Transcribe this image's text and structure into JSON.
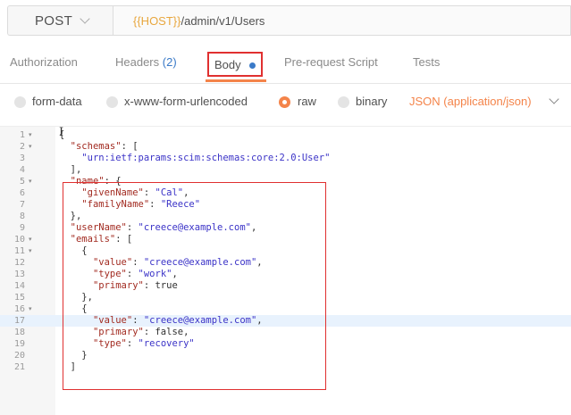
{
  "request": {
    "method": "POST",
    "url_variable": "{{HOST}}",
    "url_path": "/admin/v1/Users"
  },
  "tabs": {
    "authorization": "Authorization",
    "headers": "Headers",
    "headers_count": "(2)",
    "body": "Body",
    "pre_request": "Pre-request Script",
    "tests": "Tests"
  },
  "body_options": {
    "form_data": "form-data",
    "urlencoded": "x-www-form-urlencoded",
    "raw": "raw",
    "binary": "binary",
    "selected": "raw",
    "content_type": "JSON (application/json)"
  },
  "colors": {
    "accent": "#f4844a",
    "highlight_border": "#e03030",
    "link_blue": "#3a7ac8",
    "variable": "#e8a73f"
  },
  "editor": {
    "cursor_line": 17,
    "lines": [
      {
        "n": "1",
        "fold": true,
        "parts": [
          {
            "t": "p",
            "v": "{"
          }
        ]
      },
      {
        "n": "2",
        "fold": true,
        "parts": [
          {
            "t": "p",
            "v": "  "
          },
          {
            "t": "k",
            "v": "\"schemas\""
          },
          {
            "t": "p",
            "v": ": ["
          }
        ]
      },
      {
        "n": "3",
        "fold": false,
        "parts": [
          {
            "t": "p",
            "v": "    "
          },
          {
            "t": "s",
            "v": "\"urn:ietf:params:scim:schemas:core:2.0:User\""
          }
        ]
      },
      {
        "n": "4",
        "fold": false,
        "parts": [
          {
            "t": "p",
            "v": "  ],"
          }
        ]
      },
      {
        "n": "5",
        "fold": true,
        "parts": [
          {
            "t": "p",
            "v": "  "
          },
          {
            "t": "k",
            "v": "\"name\""
          },
          {
            "t": "p",
            "v": ": {"
          }
        ]
      },
      {
        "n": "6",
        "fold": false,
        "parts": [
          {
            "t": "p",
            "v": "    "
          },
          {
            "t": "k",
            "v": "\"givenName\""
          },
          {
            "t": "p",
            "v": ": "
          },
          {
            "t": "s",
            "v": "\"Cal\""
          },
          {
            "t": "p",
            "v": ","
          }
        ]
      },
      {
        "n": "7",
        "fold": false,
        "parts": [
          {
            "t": "p",
            "v": "    "
          },
          {
            "t": "k",
            "v": "\"familyName\""
          },
          {
            "t": "p",
            "v": ": "
          },
          {
            "t": "s",
            "v": "\"Reece\""
          }
        ]
      },
      {
        "n": "8",
        "fold": false,
        "parts": [
          {
            "t": "p",
            "v": "  },"
          }
        ]
      },
      {
        "n": "9",
        "fold": false,
        "parts": [
          {
            "t": "p",
            "v": "  "
          },
          {
            "t": "k",
            "v": "\"userName\""
          },
          {
            "t": "p",
            "v": ": "
          },
          {
            "t": "s",
            "v": "\"creece@example.com\""
          },
          {
            "t": "p",
            "v": ","
          }
        ]
      },
      {
        "n": "10",
        "fold": true,
        "parts": [
          {
            "t": "p",
            "v": "  "
          },
          {
            "t": "k",
            "v": "\"emails\""
          },
          {
            "t": "p",
            "v": ": ["
          }
        ]
      },
      {
        "n": "11",
        "fold": true,
        "parts": [
          {
            "t": "p",
            "v": "    {"
          }
        ]
      },
      {
        "n": "12",
        "fold": false,
        "parts": [
          {
            "t": "p",
            "v": "      "
          },
          {
            "t": "k",
            "v": "\"value\""
          },
          {
            "t": "p",
            "v": ": "
          },
          {
            "t": "s",
            "v": "\"creece@example.com\""
          },
          {
            "t": "p",
            "v": ","
          }
        ]
      },
      {
        "n": "13",
        "fold": false,
        "parts": [
          {
            "t": "p",
            "v": "      "
          },
          {
            "t": "k",
            "v": "\"type\""
          },
          {
            "t": "p",
            "v": ": "
          },
          {
            "t": "s",
            "v": "\"work\""
          },
          {
            "t": "p",
            "v": ","
          }
        ]
      },
      {
        "n": "14",
        "fold": false,
        "parts": [
          {
            "t": "p",
            "v": "      "
          },
          {
            "t": "k",
            "v": "\"primary\""
          },
          {
            "t": "p",
            "v": ": true"
          }
        ]
      },
      {
        "n": "15",
        "fold": false,
        "parts": [
          {
            "t": "p",
            "v": "    },"
          }
        ]
      },
      {
        "n": "16",
        "fold": true,
        "parts": [
          {
            "t": "p",
            "v": "    {"
          }
        ]
      },
      {
        "n": "17",
        "fold": false,
        "parts": [
          {
            "t": "p",
            "v": "      "
          },
          {
            "t": "k",
            "v": "\"value\""
          },
          {
            "t": "p",
            "v": ": "
          },
          {
            "t": "s",
            "v": "\"creece@example.com\""
          },
          {
            "t": "p",
            "v": ","
          }
        ]
      },
      {
        "n": "18",
        "fold": false,
        "parts": [
          {
            "t": "p",
            "v": "      "
          },
          {
            "t": "k",
            "v": "\"primary\""
          },
          {
            "t": "p",
            "v": ": false,"
          }
        ]
      },
      {
        "n": "19",
        "fold": false,
        "parts": [
          {
            "t": "p",
            "v": "      "
          },
          {
            "t": "k",
            "v": "\"type\""
          },
          {
            "t": "p",
            "v": ": "
          },
          {
            "t": "s",
            "v": "\"recovery\""
          }
        ]
      },
      {
        "n": "20",
        "fold": false,
        "parts": [
          {
            "t": "p",
            "v": "    }"
          }
        ]
      },
      {
        "n": "21",
        "fold": false,
        "parts": [
          {
            "t": "p",
            "v": "  ]"
          }
        ]
      }
    ]
  }
}
